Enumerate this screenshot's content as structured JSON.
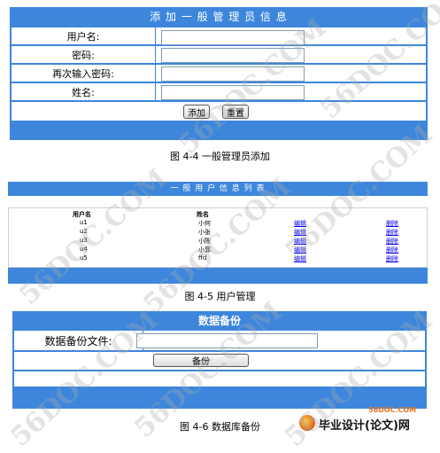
{
  "form_add_admin": {
    "title": "添 加 一 般 管 理 员 信 息",
    "fields": [
      {
        "label": "用户名:"
      },
      {
        "label": "密码:"
      },
      {
        "label": "再次输入密码:"
      },
      {
        "label": "姓名:"
      }
    ],
    "add_label": "添加",
    "reset_label": "重置",
    "caption": "图 4-4 一般管理员添加"
  },
  "user_list": {
    "title": "一 般 用 户 信 息 列 表",
    "headers": [
      "用户名",
      "姓名"
    ],
    "rows": [
      {
        "username": "u1",
        "name": "小何",
        "edit": "编辑",
        "delete": "删除"
      },
      {
        "username": "u2",
        "name": "小张",
        "edit": "编辑",
        "delete": "删除"
      },
      {
        "username": "u3",
        "name": "小陈",
        "edit": "编辑",
        "delete": "删除"
      },
      {
        "username": "u4",
        "name": "小郭",
        "edit": "编辑",
        "delete": "删除"
      },
      {
        "username": "u5",
        "name": "ffd",
        "edit": "编辑",
        "delete": "删除"
      }
    ],
    "caption": "图 4-5 用户管理"
  },
  "backup": {
    "title": "数据备份",
    "file_label": "数据备份文件:",
    "backup_label": "备份",
    "caption": "图 4-6 数据库备份"
  },
  "watermark_text": "56DOC.COM",
  "logo": {
    "site": "56DOC.COM",
    "text": "毕业设计(论文)网"
  },
  "colors": {
    "bar_blue": "#3d86dc",
    "logo_orange": "#e8741c"
  }
}
